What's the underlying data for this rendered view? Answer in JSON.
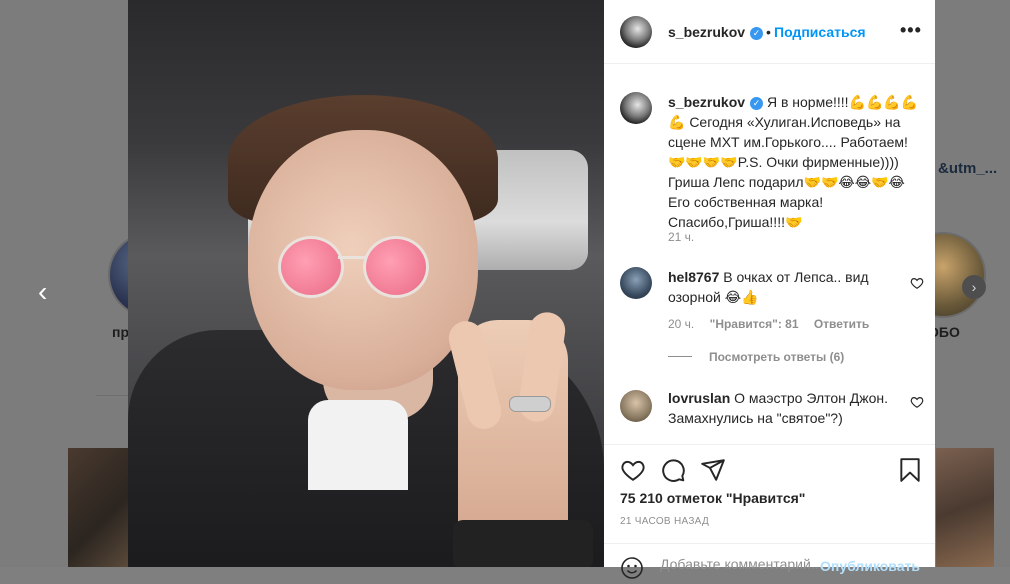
{
  "background": {
    "story_left_label": "пр",
    "story_right_label": "ОБО",
    "link_fragment": "&utm_...",
    "prev_arrow": "‹",
    "next_arrow": "›"
  },
  "post": {
    "username": "s_bezrukov",
    "follow_separator": "•",
    "follow_label": "Подписаться",
    "more_label": "•••",
    "caption": "Я в норме!!!!💪💪💪💪💪 Сегодня «Хулиган.Исповедь» на сцене МХТ им.Горького.... Работаем!🤝🤝🤝🤝P.S. Очки фирменные)))) Гриша Лепс подарил🤝🤝😂😂🤝😂Его собственная марка! Спасибо,Гриша!!!!🤝",
    "caption_time": "21 ч.",
    "likes": "75 210 отметок \"Нравится\"",
    "posted": "21 ЧАСОВ НАЗАД"
  },
  "comments": [
    {
      "username": "hel8767",
      "text": "В очках от Лепса.. вид озорной 😂👍",
      "time": "20 ч.",
      "likes": "\"Нравится\": 81",
      "reply": "Ответить",
      "view_replies": "Посмотреть ответы (6)"
    },
    {
      "username": "lovruslan",
      "text": "О маэстро Элтон Джон. Замахнулись на \"святое\"?)"
    }
  ],
  "add_comment": {
    "placeholder": "Добавьте комментарий...",
    "publish": "Опубликовать"
  },
  "icons": [
    "heart-icon",
    "comment-icon",
    "share-icon",
    "bookmark-icon",
    "emoji-icon",
    "verified-icon"
  ],
  "colors": {
    "accent": "#0095f6",
    "text": "#262626",
    "muted": "#8e8e8e",
    "verified": "#3897f0"
  }
}
